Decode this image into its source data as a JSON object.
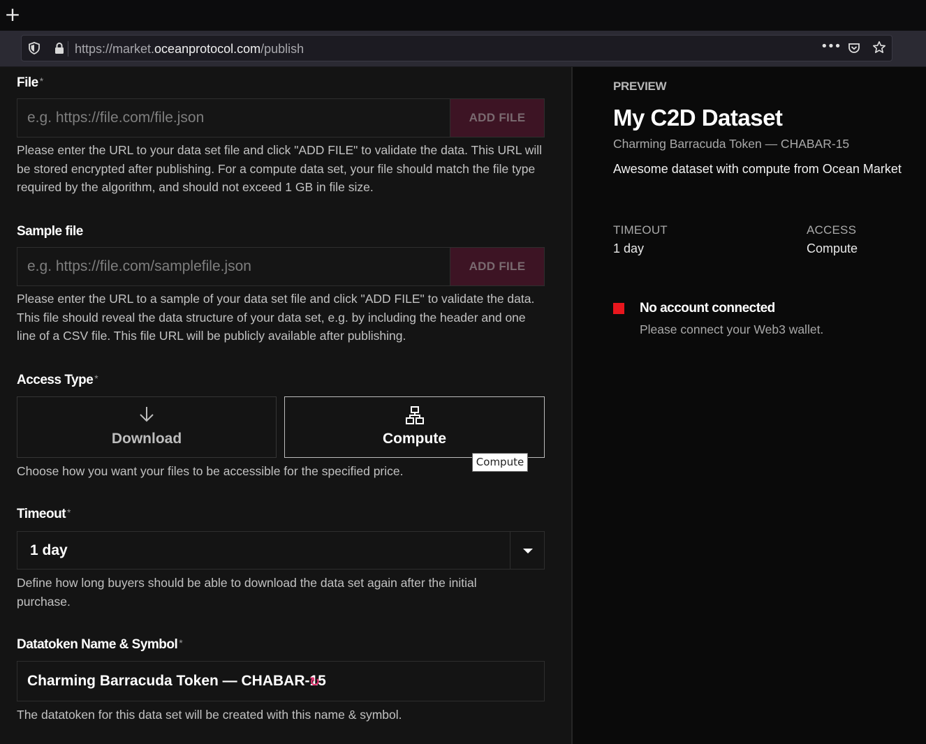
{
  "browser": {
    "new_tab_symbol": "+",
    "url_prefix": "https://market.",
    "url_host": "oceanprotocol.com",
    "url_path": "/publish",
    "menu_symbol": "•••"
  },
  "form": {
    "file": {
      "label": "File",
      "required": "*",
      "placeholder": "e.g. https://file.com/file.json",
      "button": "ADD FILE",
      "help": "Please enter the URL to your data set file and click \"ADD FILE\" to validate the data. This URL will be stored encrypted after publishing. For a compute data set, your file should match the file type required by the algorithm, and should not exceed 1 GB in file size."
    },
    "sample_file": {
      "label": "Sample file",
      "placeholder": "e.g. https://file.com/samplefile.json",
      "button": "ADD FILE",
      "help": "Please enter the URL to a sample of your data set file and click \"ADD FILE\" to validate the data. This file should reveal the data structure of your data set, e.g. by including the header and one line of a CSV file. This file URL will be publicly available after publishing."
    },
    "access_type": {
      "label": "Access Type",
      "required": "*",
      "options": [
        {
          "label": "Download",
          "icon": "arrow-down-icon",
          "selected": false
        },
        {
          "label": "Compute",
          "icon": "compute-icon",
          "selected": true
        }
      ],
      "tooltip": "Compute",
      "help": "Choose how you want your files to be accessible for the specified price."
    },
    "timeout": {
      "label": "Timeout",
      "required": "*",
      "value": "1 day",
      "help": "Define how long buyers should be able to download the data set again after the initial purchase."
    },
    "datatoken": {
      "label": "Datatoken Name & Symbol",
      "required": "*",
      "value": "Charming Barracuda Token — CHABAR-15",
      "refresh_symbol": "↻",
      "help": "The datatoken for this data set will be created with this name & symbol."
    }
  },
  "preview": {
    "kicker": "PREVIEW",
    "title": "My C2D Dataset",
    "subtitle": "Charming Barracuda Token — CHABAR-15",
    "description": "Awesome dataset with compute from Ocean Market",
    "timeout_label": "TIMEOUT",
    "timeout_value": "1 day",
    "access_label": "ACCESS",
    "access_value": "Compute",
    "warning_title": "No account connected",
    "warning_text": "Please connect your Web3 wallet.",
    "warning_color": "#e8161d"
  },
  "colors": {
    "accent": "#e2336f",
    "add_button_bg": "#3d1424"
  }
}
